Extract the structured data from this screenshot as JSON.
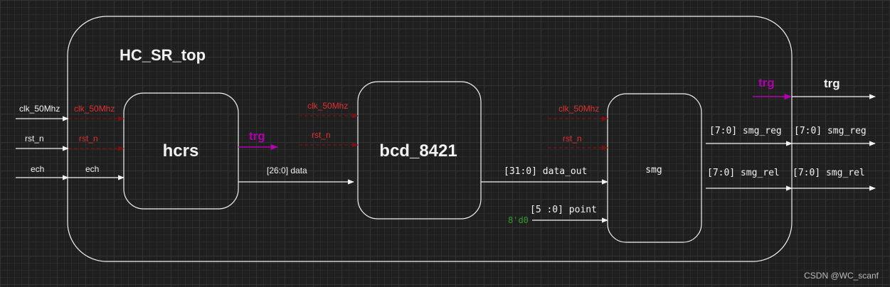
{
  "colors": {
    "white": "#f2f2f2",
    "red": "#e03030",
    "darkred": "#7a1010",
    "purple": "#b000b0",
    "green": "#2f9a2f",
    "watermark": "#bbbbbb"
  },
  "top": {
    "title": "HC_SR_top"
  },
  "modules": {
    "hcrs": "hcrs",
    "bcd": "bcd_8421",
    "smg": "smg"
  },
  "inputs": {
    "clk": "clk_50Mhz",
    "rst": "rst_n",
    "ech": "ech"
  },
  "hcrs_ports": {
    "clk": "clk_50Mhz",
    "rst": "rst_n",
    "ech": "ech",
    "trg": "trg",
    "data": "[26:0] data"
  },
  "bcd_ports": {
    "clk": "clk_50Mhz",
    "rst": "rst_n",
    "data_out": "[31:0] data_out"
  },
  "smg_ports": {
    "clk": "clk_50Mhz",
    "rst": "rst_n",
    "point": "[5 :0] point",
    "point_const": "8'd0",
    "seg_reg": "[7:0] smg_reg",
    "seg_rel": "[7:0] smg_rel"
  },
  "outputs": {
    "trg_internal": "trg",
    "trg": "trg",
    "seg_reg": "[7:0] smg_reg",
    "seg_rel": "[7:0] smg_rel"
  },
  "watermark": "CSDN @WC_scanf"
}
